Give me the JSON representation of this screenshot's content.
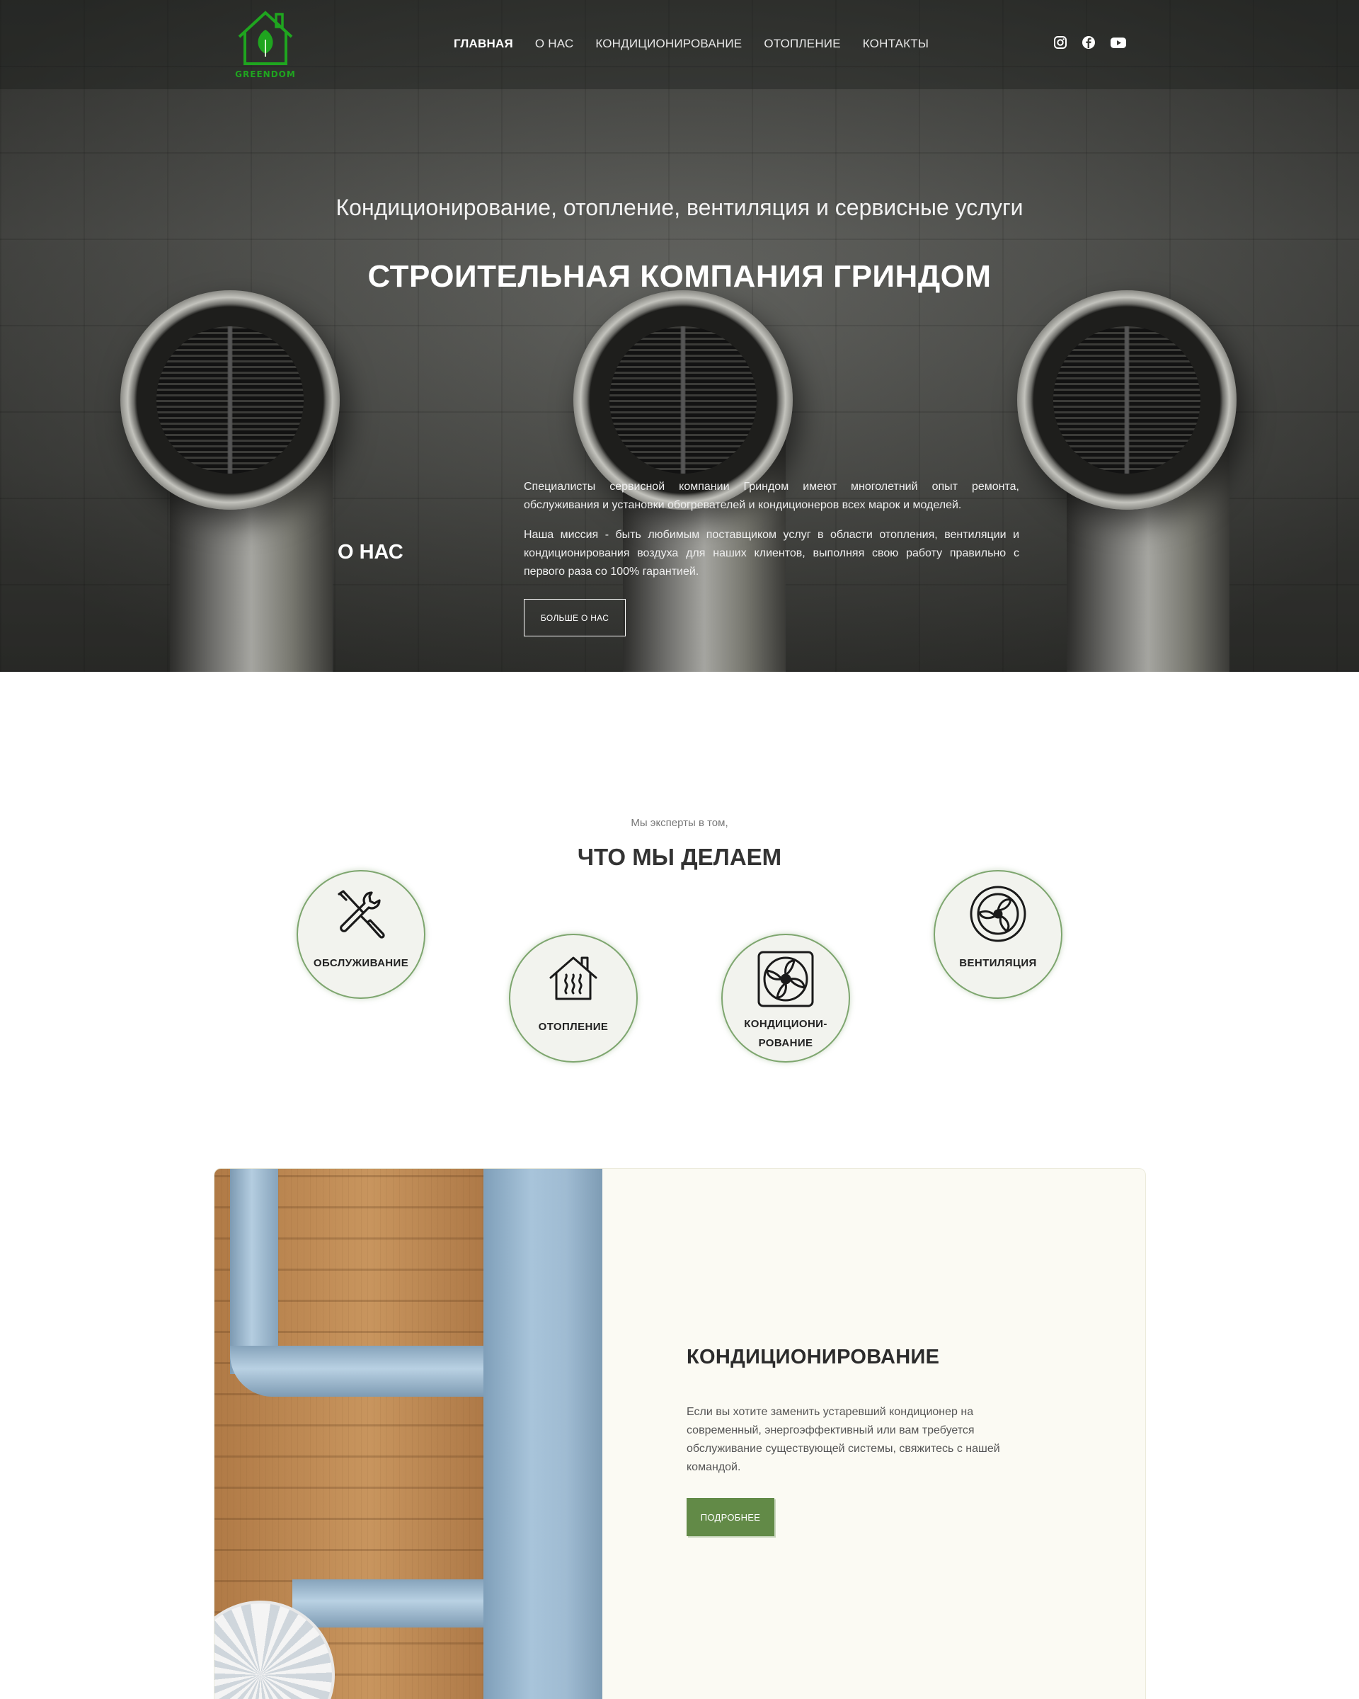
{
  "brand": {
    "logo_text": "GREENDOM",
    "accent": "#1fa51f"
  },
  "nav": {
    "items": [
      {
        "label": "ГЛАВНАЯ",
        "active": true
      },
      {
        "label": "О НАС"
      },
      {
        "label": "КОНДИЦИОНИРОВАНИЕ"
      },
      {
        "label": "ОТОПЛЕНИЕ"
      },
      {
        "label": "КОНТАКТЫ"
      }
    ],
    "social": [
      "instagram-icon",
      "facebook-icon",
      "youtube-icon"
    ]
  },
  "hero": {
    "subtitle": "Кондиционирование, отопление, вентиляция и сервисные услуги",
    "title": "СТРОИТЕЛЬНАЯ КОМПАНИЯ ГРИНДОМ",
    "about_heading": "О НАС",
    "about_p1": "Специалисты сервисной компании Гриндом имеют многолетний опыт ремонта, обслуживания и установки обогревателей и кондиционеров всех марок и моделей.",
    "about_p2": "Наша миссия - быть любимым поставщиком услуг в области отопления, вентиляции и кондиционирования воздуха для наших клиентов, выполняя свою работу правильно с первого раза со 100% гарантией.",
    "about_button": "БОЛЬШЕ О НАС"
  },
  "services": {
    "kicker": "Мы эксперты в том,",
    "title": "ЧТО МЫ ДЕЛАЕМ",
    "items": [
      {
        "label": "ОБСЛУЖИВАНИЕ",
        "icon": "tools-icon"
      },
      {
        "label": "ОТОПЛЕНИЕ",
        "icon": "house-heating-icon"
      },
      {
        "label_line1": "КОНДИЦИОНИ-",
        "label_line2": "РОВАНИЕ",
        "icon": "ac-fan-icon"
      },
      {
        "label": "ВЕНТИЛЯЦИЯ",
        "icon": "ventilation-fan-icon"
      }
    ],
    "circle_border": "#7ea66f"
  },
  "feature": {
    "title": "КОНДИЦИОНИРОВАНИЕ",
    "text": "Если вы хотите заменить устаревший кондиционер на современный, энергоэффективный или вам требуется обслуживание существующей системы, свяжитесь с нашей командой.",
    "button": "ПОДРОБНЕЕ",
    "button_color": "#628a47"
  }
}
